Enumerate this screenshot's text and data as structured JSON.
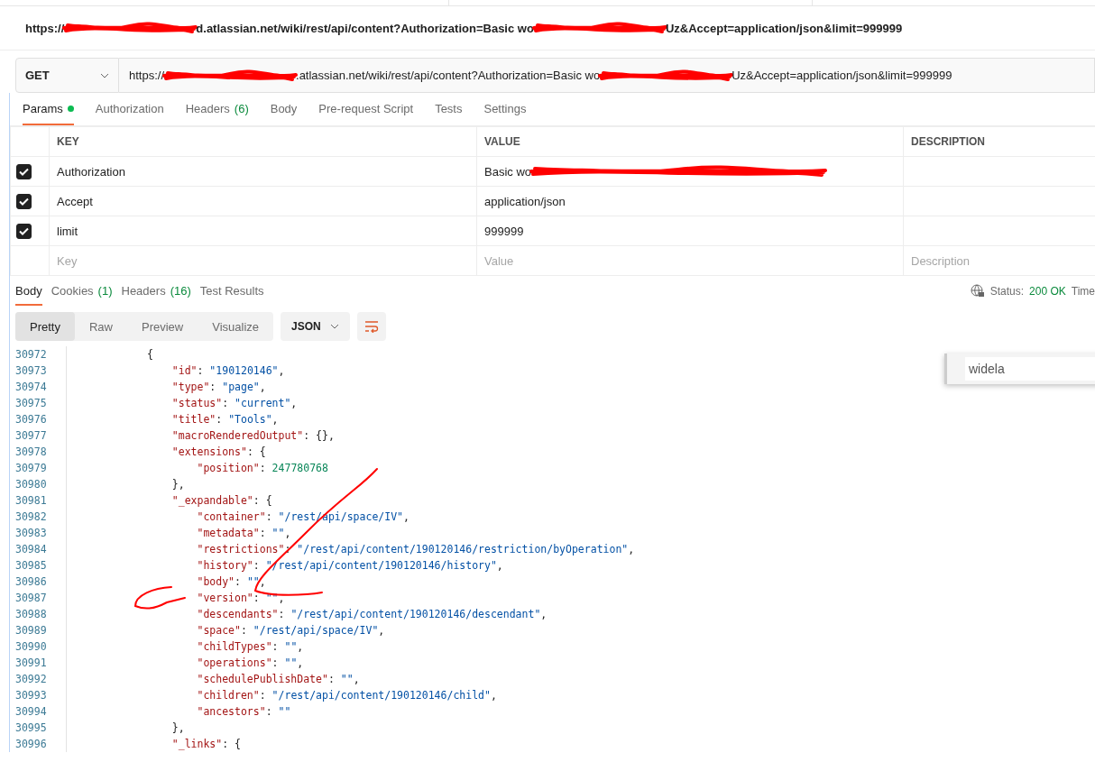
{
  "request_title": {
    "segments": [
      {
        "kind": "text",
        "text": "https://"
      },
      {
        "kind": "scribble"
      },
      {
        "kind": "text",
        "text": "d.atlassian.net/wiki/rest/api/content?Authorization=Basic wo"
      },
      {
        "kind": "scribble"
      },
      {
        "kind": "text",
        "text": "Uz&Accept=application/json&limit=999999"
      }
    ]
  },
  "request": {
    "method": "GET",
    "url": [
      {
        "kind": "text",
        "text": "https://"
      },
      {
        "kind": "scribble"
      },
      {
        "kind": "text",
        "text": ".atlassian.net/wiki/rest/api/content?Authorization=Basic wo"
      },
      {
        "kind": "scribble"
      },
      {
        "kind": "text",
        "text": "Uz&Accept=application/json&limit=999999"
      }
    ]
  },
  "request_tabs": [
    {
      "label": "Params",
      "selected": true,
      "dot": true
    },
    {
      "label": "Authorization",
      "selected": false
    },
    {
      "label": "Headers",
      "count": "(6)",
      "selected": false
    },
    {
      "label": "Body",
      "selected": false
    },
    {
      "label": "Pre-request Script",
      "selected": false
    },
    {
      "label": "Tests",
      "selected": false
    },
    {
      "label": "Settings",
      "selected": false
    }
  ],
  "params": {
    "columns": [
      "KEY",
      "VALUE",
      "DESCRIPTION"
    ],
    "rows": [
      {
        "checked": true,
        "key": "Authorization",
        "value": [
          {
            "kind": "text",
            "text": "Basic wo"
          },
          {
            "kind": "scribble"
          }
        ]
      },
      {
        "checked": true,
        "key": "Accept",
        "value": [
          {
            "kind": "text",
            "text": "application/json"
          }
        ]
      },
      {
        "checked": true,
        "key": "limit",
        "value": [
          {
            "kind": "text",
            "text": "999999"
          }
        ]
      }
    ],
    "empty_row": [
      {
        "placeholder": "Key"
      },
      {
        "placeholder": "Value"
      },
      {
        "placeholder": "Description"
      }
    ]
  },
  "response_tabs": [
    {
      "label": "Body",
      "selected": true
    },
    {
      "label": "Cookies",
      "count": "(1)",
      "selected": false
    },
    {
      "label": "Headers",
      "count": "(16)",
      "selected": false
    },
    {
      "label": "Test Results",
      "selected": false
    }
  ],
  "status": {
    "label": "Status:",
    "value": "200 OK",
    "next": "Time"
  },
  "view_modes": [
    {
      "label": "Pretty",
      "selected": true
    },
    {
      "label": "Raw",
      "selected": false
    },
    {
      "label": "Preview",
      "selected": false
    },
    {
      "label": "Visualize",
      "selected": false
    }
  ],
  "format": "JSON",
  "search_popup": {
    "value": "widela"
  },
  "code_lines": [
    {
      "num": "30972",
      "text": "            {"
    },
    {
      "num": "30973",
      "text": "                \"id\": \"190120146\","
    },
    {
      "num": "30974",
      "text": "                \"type\": \"page\","
    },
    {
      "num": "30975",
      "text": "                \"status\": \"current\","
    },
    {
      "num": "30976",
      "text": "                \"title\": \"Tools\","
    },
    {
      "num": "30977",
      "text": "                \"macroRenderedOutput\": {},"
    },
    {
      "num": "30978",
      "text": "                \"extensions\": {"
    },
    {
      "num": "30979",
      "text": "                    \"position\": 247780768"
    },
    {
      "num": "30980",
      "text": "                },"
    },
    {
      "num": "30981",
      "text": "                \"_expandable\": {"
    },
    {
      "num": "30982",
      "text": "                    \"container\": \"/rest/api/space/IV\","
    },
    {
      "num": "30983",
      "text": "                    \"metadata\": \"\","
    },
    {
      "num": "30984",
      "text": "                    \"restrictions\": \"/rest/api/content/190120146/restriction/byOperation\","
    },
    {
      "num": "30985",
      "text": "                    \"history\": \"/rest/api/content/190120146/history\","
    },
    {
      "num": "30986",
      "text": "                    \"body\": \"\","
    },
    {
      "num": "30987",
      "text": "                    \"version\": \"\","
    },
    {
      "num": "30988",
      "text": "                    \"descendants\": \"/rest/api/content/190120146/descendant\","
    },
    {
      "num": "30989",
      "text": "                    \"space\": \"/rest/api/space/IV\","
    },
    {
      "num": "30990",
      "text": "                    \"childTypes\": \"\","
    },
    {
      "num": "30991",
      "text": "                    \"operations\": \"\","
    },
    {
      "num": "30992",
      "text": "                    \"schedulePublishDate\": \"\","
    },
    {
      "num": "30993",
      "text": "                    \"children\": \"/rest/api/content/190120146/child\","
    },
    {
      "num": "30994",
      "text": "                    \"ancestors\": \"\""
    },
    {
      "num": "30995",
      "text": "                },"
    },
    {
      "num": "30996",
      "text": "                \"_links\": {"
    }
  ]
}
